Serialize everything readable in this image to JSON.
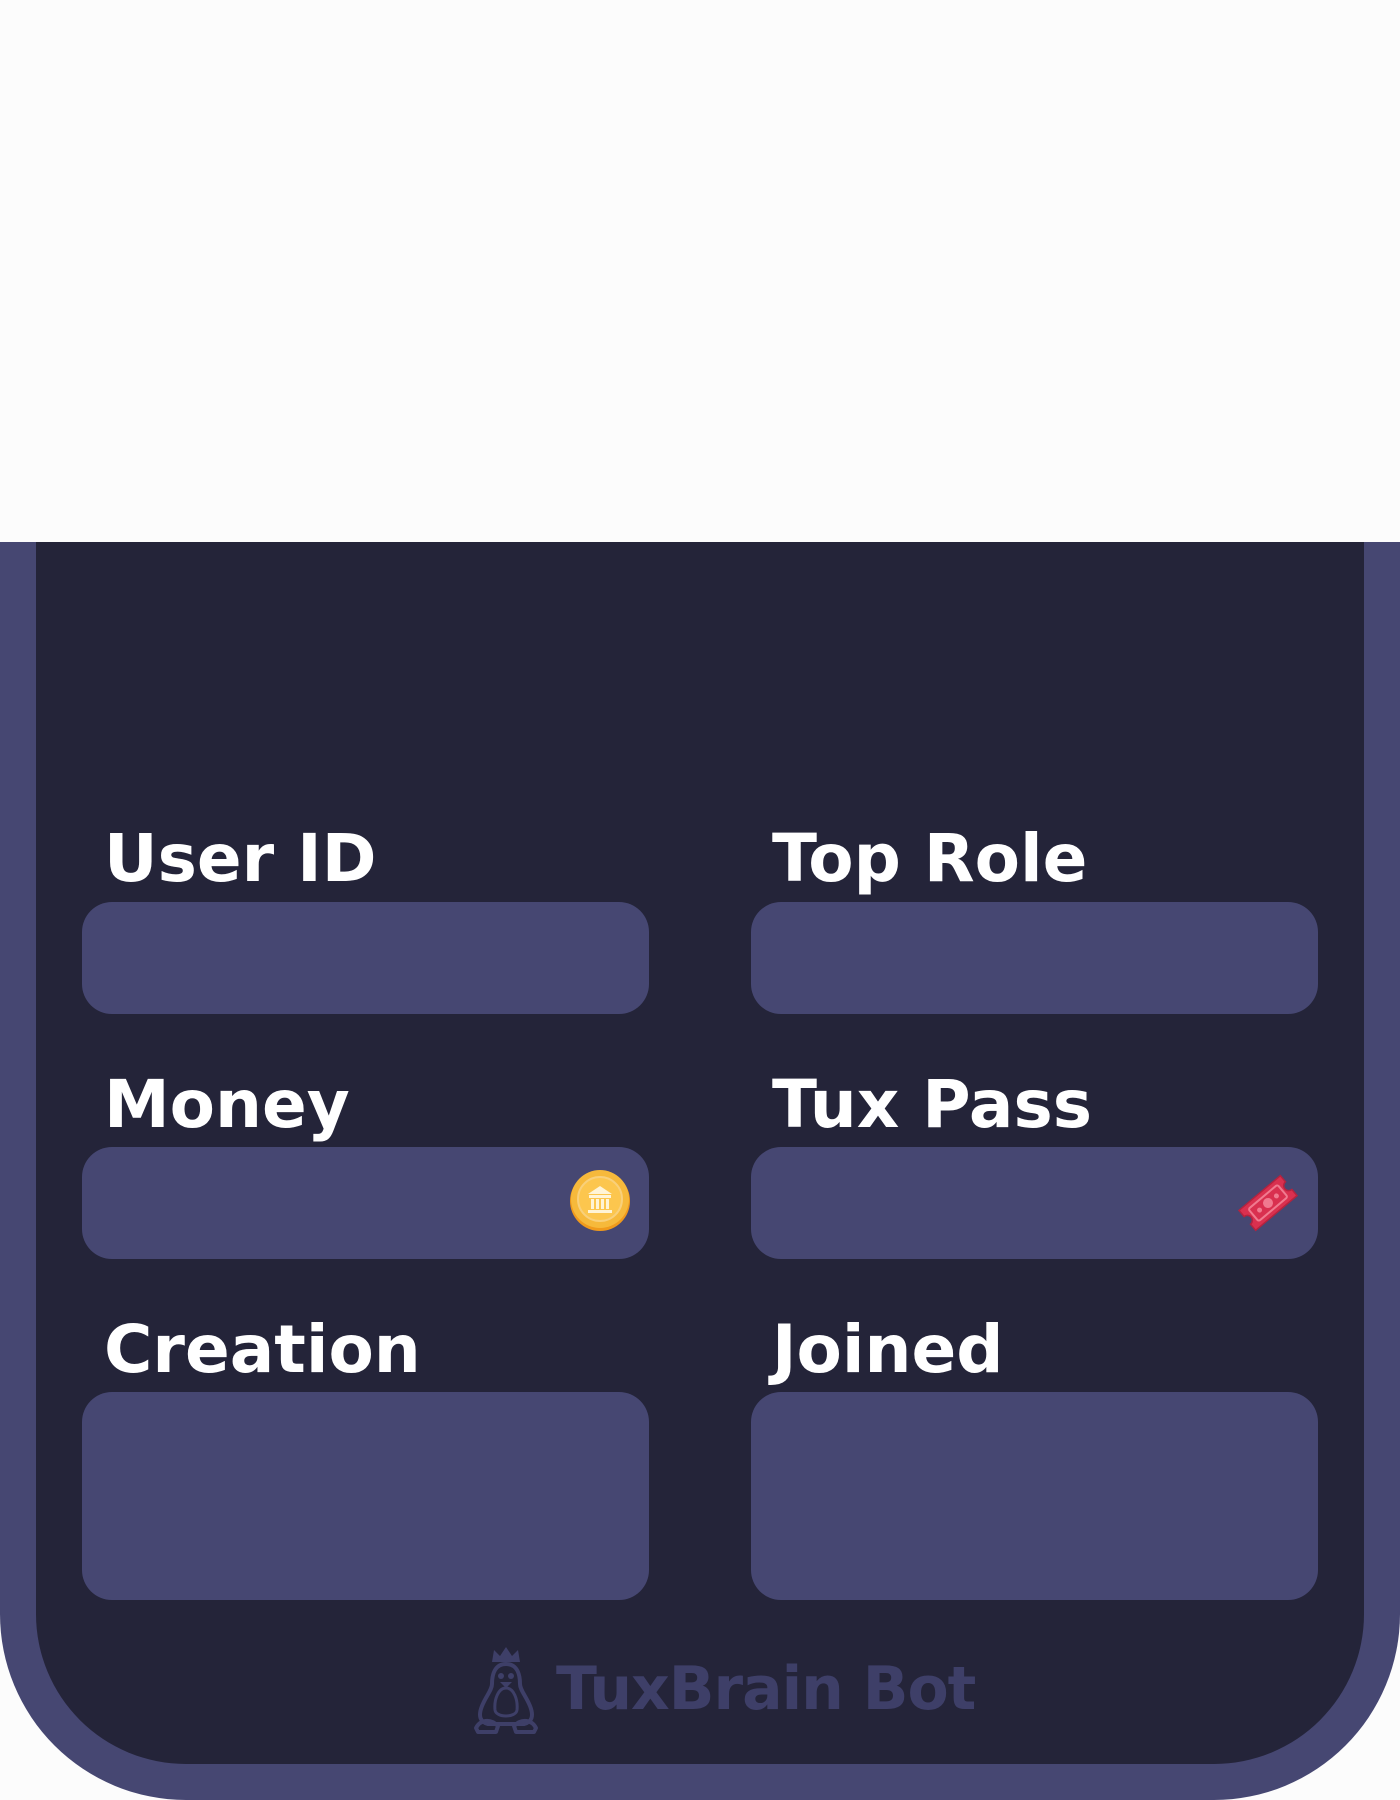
{
  "fields": [
    {
      "label": "User ID",
      "value": ""
    },
    {
      "label": "Top Role",
      "value": ""
    },
    {
      "label": "Money",
      "value": "",
      "icon": "bank-coin-icon"
    },
    {
      "label": "Tux Pass",
      "value": "",
      "icon": "ticket-icon"
    },
    {
      "label": "Creation",
      "value": ""
    },
    {
      "label": "Joined",
      "value": ""
    }
  ],
  "footer": {
    "brand": "TuxBrain Bot",
    "icon": "tux-penguin-crown-icon"
  },
  "colors": {
    "page_background": "#fcfcfc",
    "card_background": "#242439",
    "card_border": "#464772",
    "field_background": "#464772",
    "label_text": "#ffffff",
    "brand_text": "#3e3f68",
    "coin": "#f4b63a",
    "ticket": "#d9304f"
  }
}
